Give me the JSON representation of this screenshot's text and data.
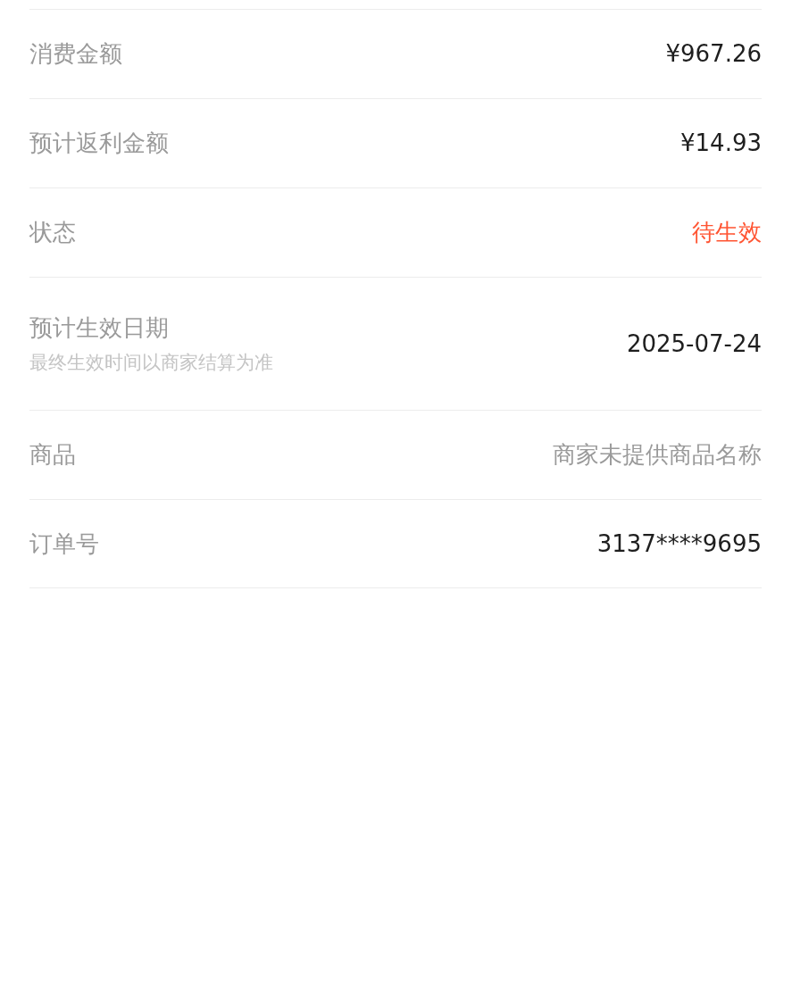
{
  "rows": [
    {
      "label": "消费金额",
      "value": "¥967.26",
      "kind": "plain"
    },
    {
      "label": "预计返利金额",
      "value": "¥14.93",
      "kind": "plain"
    },
    {
      "label": "状态",
      "value": "待生效",
      "kind": "alert"
    },
    {
      "label": "预计生效日期",
      "note": "最终生效时间以商家结算为准",
      "value": "2025-07-24",
      "kind": "plain"
    },
    {
      "label": "商品",
      "value": "商家未提供商品名称",
      "kind": "muted"
    },
    {
      "label": "订单号",
      "value": "3137****9695",
      "kind": "plain"
    }
  ]
}
